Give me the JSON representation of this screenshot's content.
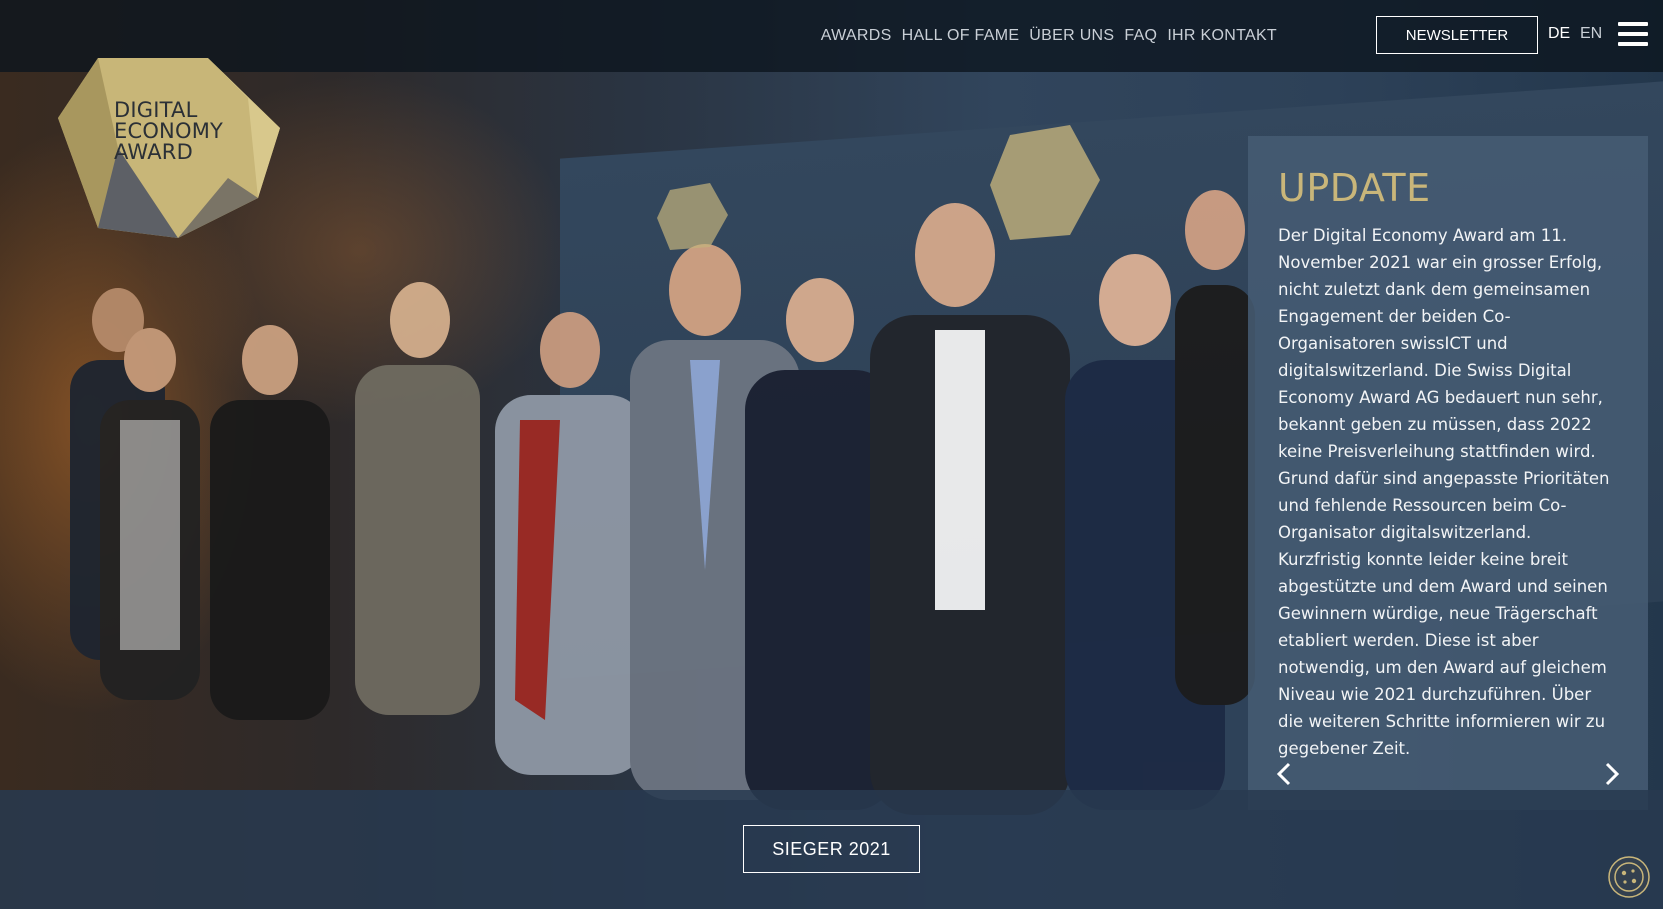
{
  "nav": {
    "items": [
      "AWARDS",
      "HALL OF FAME",
      "ÜBER UNS",
      "FAQ",
      "IHR KONTAKT"
    ],
    "newsletter_label": "NEWSLETTER",
    "languages": [
      "DE",
      "EN"
    ],
    "active_language": "DE"
  },
  "logo": {
    "lines": [
      "DIGITAL",
      "ECONOMY",
      "AWARD"
    ]
  },
  "update": {
    "title": "UPDATE",
    "text": "Der Digital Economy Award am 11. November 2021 war ein grosser Erfolg, nicht zuletzt dank dem gemeinsamen Engagement der beiden Co-Organisatoren swissICT und digitalswitzerland. Die Swiss Digital Economy Award AG bedauert nun sehr, bekannt geben zu müssen, dass 2022 keine Preisverleihung stattfinden wird. Grund dafür sind angepasste Prioritäten und fehlende Ressourcen beim Co-Organisator digitalswitzerland. Kurzfristig konnte leider keine breit abgestützte und dem Award und seinen Gewinnern würdige, neue Trägerschaft etabliert werden. Diese ist aber notwendig, um den Award auf gleichem Niveau wie 2021 durchzuführen. Über die weiteren Schritte informieren wir zu gegebener Zeit."
  },
  "cta": {
    "label": "SIEGER 2021"
  },
  "colors": {
    "accent_gold": "#c9b67a",
    "panel": "#465c73",
    "topbar": "#0c141e"
  },
  "icons": {
    "menu": "hamburger-icon",
    "prev": "chevron-left-icon",
    "next": "chevron-right-icon",
    "cookie": "cookie-icon"
  }
}
